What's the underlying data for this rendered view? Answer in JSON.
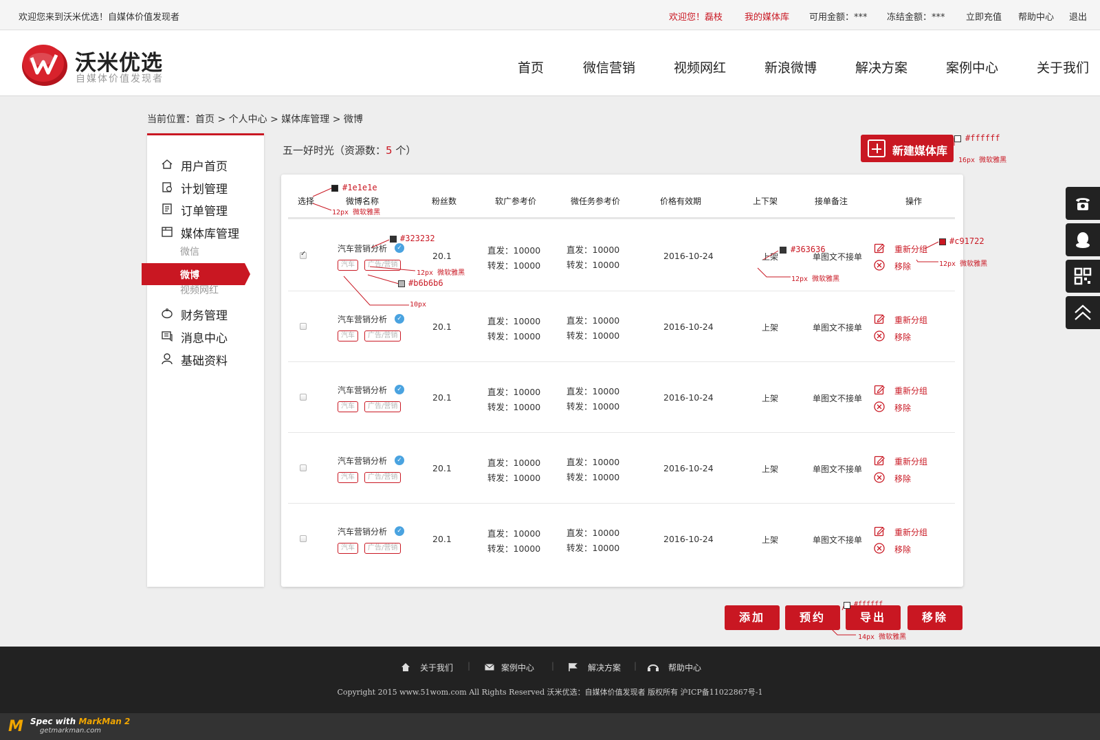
{
  "topbar": {
    "welcome": "欢迎您来到沃米优选！自媒体价值发现者",
    "greeting": "欢迎您！磊枝",
    "my_library": "我的媒体库",
    "available": "可用金额：***",
    "frozen": "冻结金额：***",
    "recharge": "立即充值",
    "help": "帮助中心",
    "logout": "退出"
  },
  "brand": {
    "name": "沃米优选",
    "slogan": "自媒体价值发现者"
  },
  "nav": [
    "首页",
    "微信营销",
    "视频网红",
    "新浪微博",
    "解决方案",
    "案例中心",
    "关于我们"
  ],
  "breadcrumb": "当前位置：首页 > 个人中心 > 媒体库管理 > 微博",
  "sidebar": {
    "items": [
      "用户首页",
      "计划管理",
      "订单管理",
      "媒体库管理",
      "财务管理",
      "消息中心",
      "基础资料"
    ],
    "subitems": [
      "微信",
      "微博",
      "视频网红"
    ]
  },
  "resource": {
    "prefix": "五一好时光（资源数：",
    "count": "5",
    "suffix": "个）"
  },
  "new_library_button": "新建媒体库",
  "table": {
    "headers": [
      "选择",
      "微博名称",
      "粉丝数",
      "软广参考价",
      "微任务参考价",
      "价格有效期",
      "上下架",
      "接单备注",
      "操作"
    ],
    "rows": [
      {
        "checked": true,
        "name": "汽车营销分析",
        "tag1": "汽车",
        "tag2": "广告/营销",
        "fans": "20.1",
        "soft_direct": "直发：10000",
        "soft_forward": "转发：10000",
        "task_direct": "直发：10000",
        "task_forward": "转发：10000",
        "valid": "2016-10-24",
        "status": "上架",
        "note": "单图文不接单",
        "op1": "重新分组",
        "op2": "移除"
      },
      {
        "checked": false,
        "name": "汽车营销分析",
        "tag1": "汽车",
        "tag2": "广告/营销",
        "fans": "20.1",
        "soft_direct": "直发：10000",
        "soft_forward": "转发：10000",
        "task_direct": "直发：10000",
        "task_forward": "转发：10000",
        "valid": "2016-10-24",
        "status": "上架",
        "note": "单图文不接单",
        "op1": "重新分组",
        "op2": "移除"
      },
      {
        "checked": false,
        "name": "汽车营销分析",
        "tag1": "汽车",
        "tag2": "广告/营销",
        "fans": "20.1",
        "soft_direct": "直发：10000",
        "soft_forward": "转发：10000",
        "task_direct": "直发：10000",
        "task_forward": "转发：10000",
        "valid": "2016-10-24",
        "status": "上架",
        "note": "单图文不接单",
        "op1": "重新分组",
        "op2": "移除"
      },
      {
        "checked": false,
        "name": "汽车营销分析",
        "tag1": "汽车",
        "tag2": "广告/营销",
        "fans": "20.1",
        "soft_direct": "直发：10000",
        "soft_forward": "转发：10000",
        "task_direct": "直发：10000",
        "task_forward": "转发：10000",
        "valid": "2016-10-24",
        "status": "上架",
        "note": "单图文不接单",
        "op1": "重新分组",
        "op2": "移除"
      },
      {
        "checked": false,
        "name": "汽车营销分析",
        "tag1": "汽车",
        "tag2": "广告/营销",
        "fans": "20.1",
        "soft_direct": "直发：10000",
        "soft_forward": "转发：10000",
        "task_direct": "直发：10000",
        "task_forward": "转发：10000",
        "valid": "2016-10-24",
        "status": "上架",
        "note": "单图文不接单",
        "op1": "重新分组",
        "op2": "移除"
      }
    ]
  },
  "buttons": [
    "添加",
    "预约",
    "导出",
    "移除"
  ],
  "annotations": {
    "btn_color": "#ffffff",
    "btn_font": "16px 微软雅黑",
    "header_color": "#1e1e1e",
    "header_font": "12px 微软雅黑",
    "name_color": "#323232",
    "name_font": "12px 微软雅黑",
    "tag_color": "#b6b6b6",
    "tag_font": "10px",
    "status_color": "#363636",
    "status_font": "12px 微软雅黑",
    "op_color": "#c91722",
    "op_font": "12px 微软雅黑",
    "bottom_color": "#ffffff",
    "bottom_font": "14px 微软雅黑"
  },
  "footer": {
    "links": [
      "关于我们",
      "案例中心",
      "解决方案",
      "帮助中心"
    ],
    "copyright": "Copyright 2015 www.51wom.com All Rights Reserved 沃米优选：自媒体价值发现者 版权所有 沪ICP备11022867号-1"
  },
  "markman": {
    "title_prefix": "Spec with ",
    "title_brand": "MarkMan 2",
    "url": "getmarkman.com"
  },
  "colors": {
    "accent": "#c91722",
    "text": "#323232",
    "muted": "#b6b6b6",
    "footer": "#222222"
  }
}
